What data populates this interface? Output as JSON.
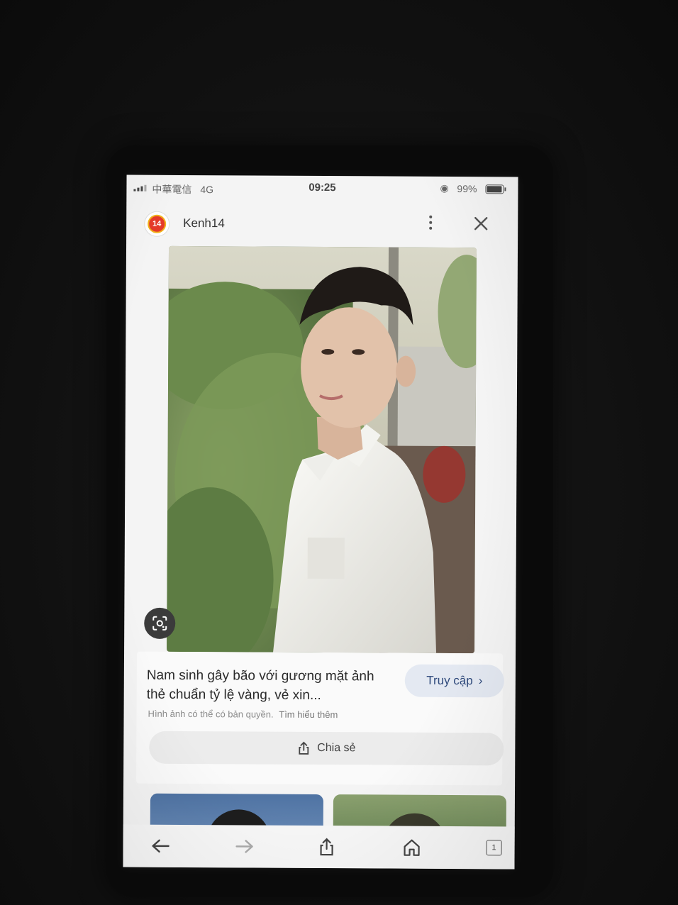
{
  "status_bar": {
    "carrier": "中華電信",
    "network": "4G",
    "time": "09:25",
    "battery": "99%",
    "battery_level": 0.99
  },
  "header": {
    "source_logo_text": "14",
    "source_name": "Kenh14"
  },
  "image_viewer": {
    "lens_icon": "google-lens-icon",
    "menu_icon": "more-vertical-icon",
    "close_icon": "close-icon"
  },
  "result": {
    "title": "Nam sinh gây bão với gương mặt ảnh thẻ chuẩn tỷ lệ vàng, vẻ xin...",
    "visit_label": "Truy cập",
    "copyright_notice": "Hình ảnh có thể có bản quyền.",
    "learn_more": "Tìm hiểu thêm",
    "share_label": "Chia sẻ"
  },
  "toolbar": {
    "tab_count": "1",
    "icons": [
      "back-arrow-icon",
      "forward-arrow-icon",
      "share-icon",
      "home-icon",
      "tabs-icon"
    ]
  },
  "colors": {
    "accent_visit_bg": "#e4e9f2",
    "accent_visit_text": "#2f4a7c",
    "logo_red": "#e53a2a"
  }
}
